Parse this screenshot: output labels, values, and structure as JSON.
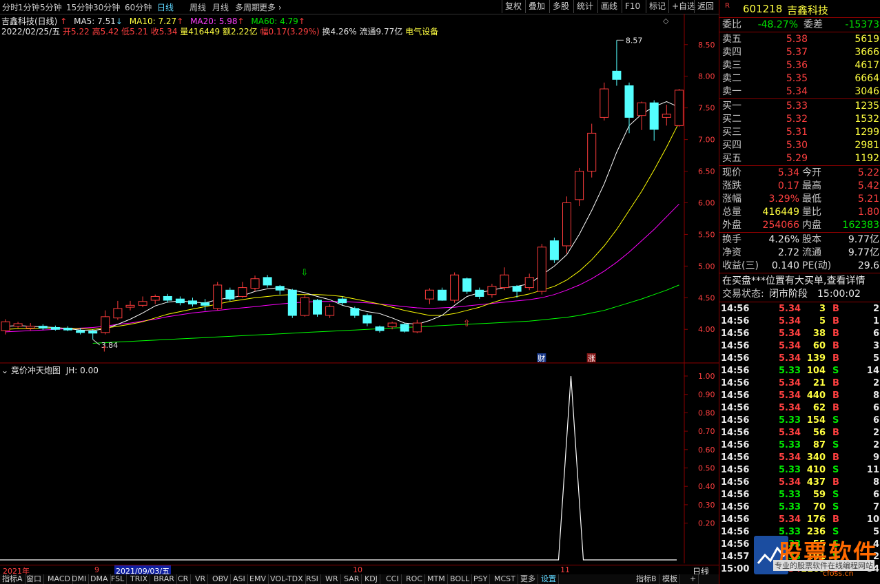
{
  "toolbar": {
    "periods": [
      "分时",
      "1分钟",
      "5分钟",
      "15分钟",
      "30分钟",
      "60分钟",
      "日线",
      "周线",
      "月线",
      "多周期",
      "更多"
    ],
    "active": "日线",
    "more_arrow": "›",
    "buttons": [
      "复权",
      "叠加",
      "多股",
      "统计",
      "画线",
      "F10",
      "标记",
      "+自选",
      "返回"
    ]
  },
  "stock": {
    "name_line": "吉鑫科技(日线)",
    "ma5": "MA5: 7.51",
    "ma10": "MA10: 7.27",
    "ma20": "MA20: 5.98",
    "ma60": "MA60: 4.79",
    "date": "2022/02/25/五",
    "open": "开5.22",
    "high": "高5.42",
    "low": "低5.21",
    "close": "收5.34",
    "vol": "量416449",
    "amount": "额2.22亿",
    "change": "幅0.17(3.29%)",
    "turnover": "换4.26%",
    "float": "流通9.77亿",
    "sector": "电气设备"
  },
  "chart_data": {
    "type": "candlestick",
    "y_ticks": [
      "8.50",
      "8.00",
      "7.50",
      "7.00",
      "6.50",
      "6.00",
      "5.50",
      "5.00",
      "4.50",
      "4.00"
    ],
    "ylim": [
      3.6,
      8.9
    ],
    "max_label": "8.57",
    "min_label": "3.84",
    "candles": [
      [
        3.98,
        4.12,
        4.16,
        3.92
      ],
      [
        4.05,
        4.09,
        4.12,
        4.02
      ],
      [
        4.02,
        4.05,
        4.1,
        3.98
      ],
      [
        4.05,
        4.02,
        4.08,
        3.99
      ],
      [
        4.03,
        4.0,
        4.06,
        3.98
      ],
      [
        4.02,
        3.99,
        4.05,
        3.97
      ],
      [
        3.98,
        3.95,
        4.02,
        3.92
      ],
      [
        3.97,
        3.94,
        4.0,
        3.84
      ],
      [
        3.95,
        4.2,
        4.3,
        3.92
      ],
      [
        4.18,
        4.33,
        4.45,
        4.15
      ],
      [
        4.35,
        4.38,
        4.45,
        4.3
      ],
      [
        4.38,
        4.44,
        4.52,
        4.35
      ],
      [
        4.46,
        4.52,
        4.55,
        4.4
      ],
      [
        4.52,
        4.46,
        4.56,
        4.42
      ],
      [
        4.48,
        4.42,
        4.52,
        4.38
      ],
      [
        4.45,
        4.4,
        4.5,
        4.36
      ],
      [
        4.42,
        4.38,
        4.48,
        4.3
      ],
      [
        4.33,
        4.7,
        4.75,
        4.3
      ],
      [
        4.62,
        4.48,
        4.66,
        4.45
      ],
      [
        4.52,
        4.66,
        4.75,
        4.5
      ],
      [
        4.65,
        4.8,
        4.85,
        4.6
      ],
      [
        4.82,
        4.7,
        4.86,
        4.66
      ],
      [
        4.68,
        4.62,
        4.7,
        4.55
      ],
      [
        4.62,
        4.22,
        4.64,
        4.18
      ],
      [
        4.22,
        4.5,
        4.55,
        4.2
      ],
      [
        4.46,
        4.24,
        4.48,
        4.2
      ],
      [
        4.22,
        4.36,
        4.4,
        4.18
      ],
      [
        4.48,
        4.42,
        4.52,
        4.38
      ],
      [
        4.33,
        4.22,
        4.36,
        4.18
      ],
      [
        4.22,
        4.1,
        4.25,
        4.05
      ],
      [
        4.04,
        3.98,
        4.06,
        3.95
      ],
      [
        4.04,
        4.1,
        4.12,
        4.0
      ],
      [
        4.08,
        3.97,
        4.1,
        3.95
      ],
      [
        3.96,
        4.1,
        4.15,
        3.94
      ],
      [
        4.48,
        4.62,
        4.65,
        4.4
      ],
      [
        4.62,
        4.46,
        4.66,
        4.45
      ],
      [
        4.46,
        4.86,
        4.9,
        4.42
      ],
      [
        4.8,
        4.6,
        4.82,
        4.56
      ],
      [
        4.62,
        4.52,
        4.66,
        4.48
      ],
      [
        4.55,
        4.68,
        4.72,
        4.5
      ],
      [
        4.66,
        4.86,
        4.98,
        4.62
      ],
      [
        4.68,
        4.6,
        4.7,
        4.5
      ],
      [
        4.66,
        4.82,
        4.88,
        4.62
      ],
      [
        4.6,
        5.3,
        5.35,
        4.55
      ],
      [
        5.4,
        5.1,
        5.45,
        5.05
      ],
      [
        5.32,
        6.0,
        6.1,
        5.2
      ],
      [
        6.05,
        6.5,
        6.55,
        5.95
      ],
      [
        6.5,
        7.1,
        7.25,
        6.4
      ],
      [
        7.35,
        7.8,
        7.9,
        7.3
      ],
      [
        8.08,
        7.95,
        8.57,
        7.85
      ],
      [
        7.85,
        7.35,
        7.9,
        7.1
      ],
      [
        7.38,
        7.58,
        7.6,
        7.15
      ],
      [
        7.58,
        7.16,
        7.62,
        6.98
      ],
      [
        7.35,
        7.4,
        7.55,
        7.22
      ],
      [
        7.22,
        7.78,
        7.8,
        7.2
      ]
    ],
    "ma5": [
      4.05,
      4.06,
      4.05,
      4.04,
      4.03,
      4.01,
      3.99,
      3.98,
      4.01,
      4.08,
      4.16,
      4.26,
      4.37,
      4.43,
      4.45,
      4.43,
      4.42,
      4.47,
      4.5,
      4.53,
      4.6,
      4.64,
      4.66,
      4.62,
      4.58,
      4.52,
      4.47,
      4.38,
      4.33,
      4.28,
      4.25,
      4.18,
      4.1,
      4.08,
      4.14,
      4.22,
      4.38,
      4.52,
      4.58,
      4.62,
      4.66,
      4.68,
      4.72,
      4.86,
      5.0,
      5.18,
      5.5,
      5.88,
      6.3,
      6.8,
      7.22,
      7.4,
      7.52,
      7.6,
      7.51
    ],
    "ma10": [
      4.0,
      4.01,
      4.01,
      4.02,
      4.02,
      4.02,
      4.01,
      4.0,
      4.02,
      4.05,
      4.08,
      4.12,
      4.18,
      4.24,
      4.28,
      4.32,
      4.36,
      4.4,
      4.44,
      4.47,
      4.5,
      4.52,
      4.54,
      4.55,
      4.55,
      4.55,
      4.54,
      4.52,
      4.48,
      4.44,
      4.4,
      4.35,
      4.3,
      4.26,
      4.22,
      4.22,
      4.25,
      4.3,
      4.35,
      4.42,
      4.48,
      4.52,
      4.56,
      4.62,
      4.68,
      4.78,
      4.92,
      5.1,
      5.32,
      5.58,
      5.88,
      6.18,
      6.52,
      6.88,
      7.27
    ],
    "ma20": [
      3.96,
      3.97,
      3.98,
      3.99,
      4.0,
      4.01,
      4.02,
      4.03,
      4.05,
      4.08,
      4.1,
      4.13,
      4.16,
      4.2,
      4.23,
      4.26,
      4.28,
      4.3,
      4.32,
      4.34,
      4.36,
      4.38,
      4.4,
      4.42,
      4.43,
      4.44,
      4.44,
      4.44,
      4.43,
      4.42,
      4.4,
      4.38,
      4.36,
      4.34,
      4.33,
      4.34,
      4.35,
      4.37,
      4.39,
      4.41,
      4.43,
      4.45,
      4.47,
      4.5,
      4.55,
      4.62,
      4.7,
      4.8,
      4.92,
      5.06,
      5.22,
      5.4,
      5.58,
      5.78,
      5.98
    ],
    "ma60_start": 7,
    "ma60": [
      3.78,
      3.79,
      3.8,
      3.81,
      3.82,
      3.83,
      3.84,
      3.85,
      3.86,
      3.87,
      3.88,
      3.89,
      3.9,
      3.91,
      3.92,
      3.93,
      3.94,
      3.95,
      3.96,
      3.97,
      3.98,
      3.99,
      4.0,
      4.01,
      4.02,
      4.03,
      4.04,
      4.05,
      4.06,
      4.07,
      4.08,
      4.09,
      4.1,
      4.11,
      4.12,
      4.13,
      4.15,
      4.17,
      4.19,
      4.22,
      4.26,
      4.3,
      4.36,
      4.42,
      4.48,
      4.55,
      4.62,
      4.7
    ],
    "markers": {
      "fin": "财",
      "rise": "涨"
    }
  },
  "sub_chart": {
    "title": "竞价冲天炮图",
    "jh": "JH: 0.00",
    "y_ticks": [
      "1.00",
      "0.90",
      "0.80",
      "0.70",
      "0.60",
      "0.50",
      "0.40",
      "0.30",
      "0.20"
    ],
    "spike_index": 45,
    "values_note": "0 except 1 at spike"
  },
  "timebar": {
    "year": "2021年",
    "m9": "9",
    "date_box": "2021/09/03/五",
    "m10": "10",
    "m11": "11",
    "period": "日线"
  },
  "indicators": [
    "指标A",
    "窗口",
    "MACD",
    "DMI",
    "DMA",
    "FSL",
    "TRIX",
    "BRAR",
    "CR",
    "VR",
    "OBV",
    "ASI",
    "EMV",
    "VOL-TDX",
    "RSI",
    "WR",
    "SAR",
    "KDJ",
    "CCI",
    "ROC",
    "MTM",
    "BOLL",
    "PSY",
    "MCST",
    "更多",
    "设置"
  ],
  "ind_right": [
    "指标B",
    "模板",
    "+"
  ],
  "right_panel": {
    "flag": "R",
    "code": "601218",
    "name": "吉鑫科技",
    "weibi_label": "委比",
    "weibi": "-48.27%",
    "weicha_label": "委差",
    "weicha": "-15373",
    "asks": [
      {
        "label": "卖五",
        "price": "5.38",
        "vol": "5619"
      },
      {
        "label": "卖四",
        "price": "5.37",
        "vol": "3666"
      },
      {
        "label": "卖三",
        "price": "5.36",
        "vol": "4617"
      },
      {
        "label": "卖二",
        "price": "5.35",
        "vol": "6664"
      },
      {
        "label": "卖一",
        "price": "5.34",
        "vol": "3046"
      }
    ],
    "bids": [
      {
        "label": "买一",
        "price": "5.33",
        "vol": "1235"
      },
      {
        "label": "买二",
        "price": "5.32",
        "vol": "1532"
      },
      {
        "label": "买三",
        "price": "5.31",
        "vol": "1299"
      },
      {
        "label": "买四",
        "price": "5.30",
        "vol": "2981"
      },
      {
        "label": "买五",
        "price": "5.29",
        "vol": "1192"
      }
    ],
    "quote": [
      {
        "l1": "现价",
        "v1": "5.34",
        "c1": "red",
        "l2": "今开",
        "v2": "5.22",
        "c2": "red"
      },
      {
        "l1": "涨跌",
        "v1": "0.17",
        "c1": "red",
        "l2": "最高",
        "v2": "5.42",
        "c2": "red"
      },
      {
        "l1": "涨幅",
        "v1": "3.29%",
        "c1": "red",
        "l2": "最低",
        "v2": "5.21",
        "c2": "red"
      },
      {
        "l1": "总量",
        "v1": "416449",
        "c1": "yellow",
        "l2": "量比",
        "v2": "1.80",
        "c2": "red"
      },
      {
        "l1": "外盘",
        "v1": "254066",
        "c1": "red",
        "l2": "内盘",
        "v2": "162383",
        "c2": "green"
      }
    ],
    "fund": [
      {
        "l1": "换手",
        "v1": "4.26%",
        "l2": "股本",
        "v2": "9.77亿"
      },
      {
        "l1": "净资",
        "v1": "2.72",
        "l2": "流通",
        "v2": "9.77亿"
      },
      {
        "l1": "收益(三)",
        "v1": "0.140",
        "l2": "PE(动)",
        "v2": "29.6"
      }
    ],
    "notice": "在买盘***位置有大买单,查看详情",
    "status_label": "交易状态:",
    "status": "闭市阶段",
    "status_time": "15:00:02",
    "ticks": [
      [
        "14:56",
        "5.34",
        "3",
        "B",
        "2"
      ],
      [
        "14:56",
        "5.34",
        "5",
        "B",
        "1"
      ],
      [
        "14:56",
        "5.34",
        "38",
        "B",
        "6"
      ],
      [
        "14:56",
        "5.34",
        "60",
        "B",
        "3"
      ],
      [
        "14:56",
        "5.34",
        "139",
        "B",
        "5"
      ],
      [
        "14:56",
        "5.33",
        "104",
        "S",
        "14"
      ],
      [
        "14:56",
        "5.34",
        "21",
        "B",
        "2"
      ],
      [
        "14:56",
        "5.34",
        "440",
        "B",
        "8"
      ],
      [
        "14:56",
        "5.34",
        "62",
        "B",
        "6"
      ],
      [
        "14:56",
        "5.33",
        "154",
        "S",
        "6"
      ],
      [
        "14:56",
        "5.34",
        "56",
        "B",
        "2"
      ],
      [
        "14:56",
        "5.33",
        "87",
        "S",
        "2"
      ],
      [
        "14:56",
        "5.34",
        "340",
        "B",
        "9"
      ],
      [
        "14:56",
        "5.33",
        "410",
        "S",
        "11"
      ],
      [
        "14:56",
        "5.34",
        "437",
        "B",
        "8"
      ],
      [
        "14:56",
        "5.33",
        "59",
        "S",
        "6"
      ],
      [
        "14:56",
        "5.33",
        "70",
        "S",
        "7"
      ],
      [
        "14:56",
        "5.34",
        "176",
        "B",
        "10"
      ],
      [
        "14:56",
        "5.33",
        "236",
        "S",
        "5"
      ],
      [
        "14:56",
        "5.33",
        "55",
        "S",
        "4"
      ],
      [
        "14:57",
        "5.33",
        "191",
        "S",
        "2"
      ],
      [
        "15:00",
        "5.34",
        "1169",
        "B",
        "54"
      ]
    ]
  },
  "watermark": {
    "title": "股票软件",
    "sub": "专业的股票软件在线编程网站",
    "site": "cfoss.cn"
  },
  "colors": {
    "up": "#ff3c3c",
    "down": "#54ffff",
    "ma5": "#ffffff",
    "ma10": "#ffff00",
    "ma20": "#ff00ff",
    "ma60": "#00ff00",
    "axis": "#8b0000"
  }
}
